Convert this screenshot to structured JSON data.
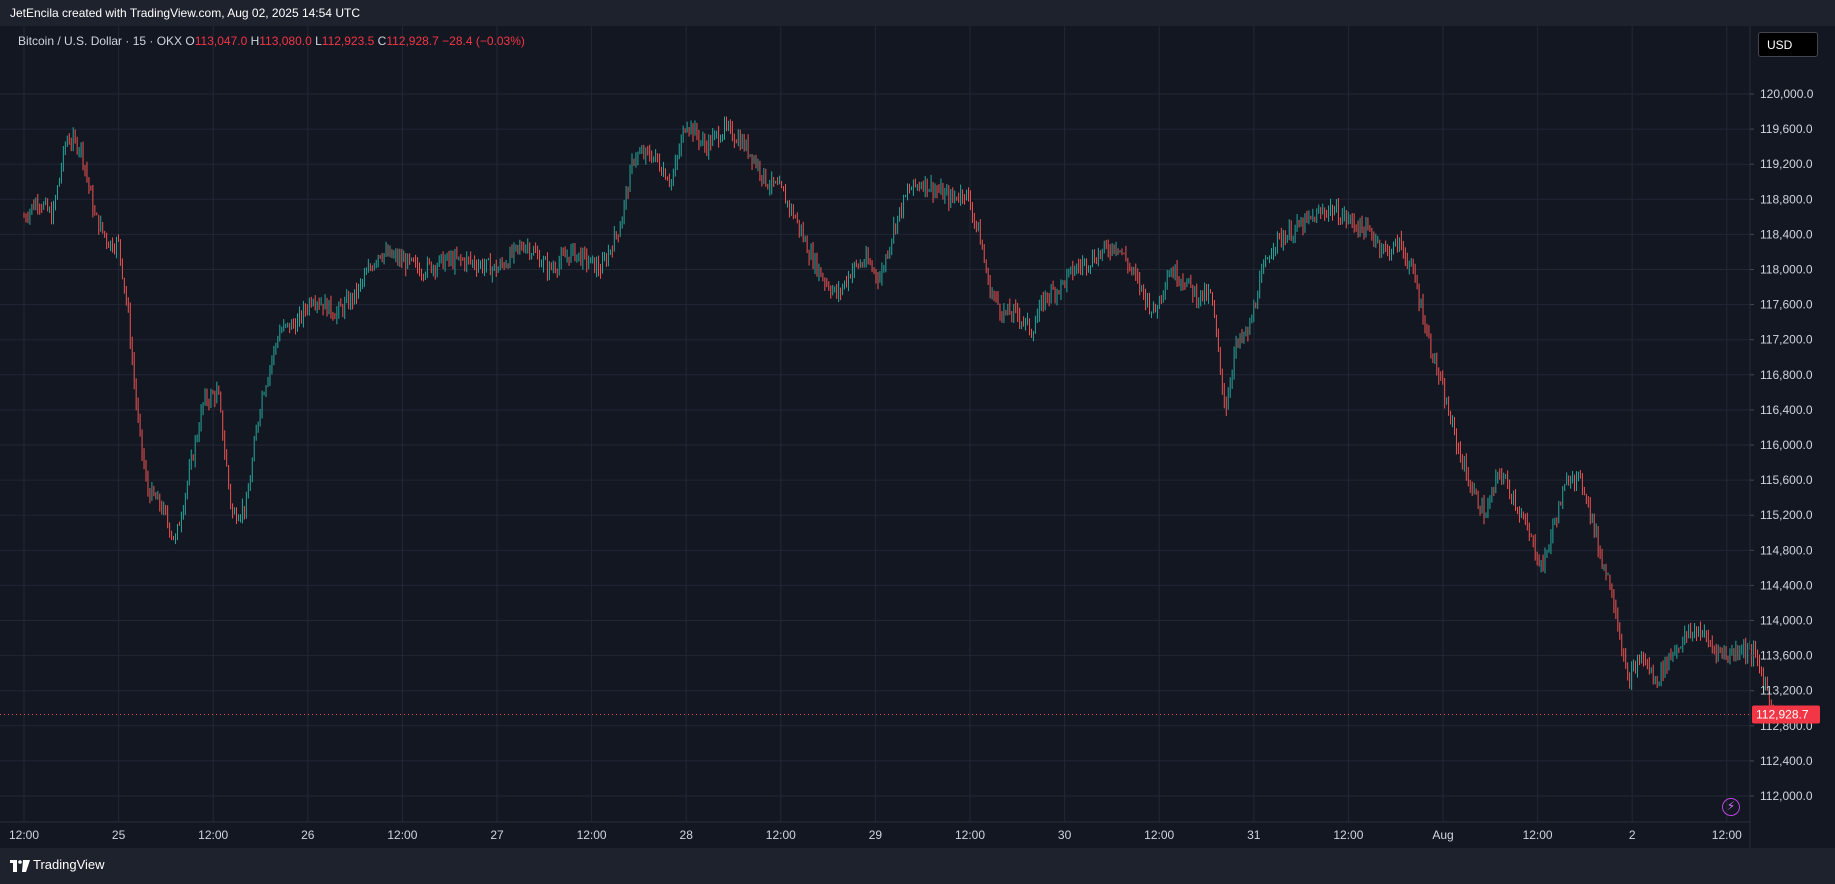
{
  "header": {
    "caption": "JetEncila created with TradingView.com, Aug 02, 2025 14:54 UTC"
  },
  "legend": {
    "symbol": "Bitcoin / U.S. Dollar · 15 · OKX",
    "o_label": "O",
    "o_value": "113,047.0",
    "h_label": "H",
    "h_value": "113,080.0",
    "l_label": "L",
    "l_value": "112,923.5",
    "c_label": "C",
    "c_value": "112,928.7",
    "change": "−28.4 (−0.03%)"
  },
  "currency_button": "USD",
  "last_price_label": "112,928.7",
  "footer": {
    "brand": "TradingView"
  },
  "colors": {
    "background": "#131722",
    "grid": "#232735",
    "up": "#26a69a",
    "down": "#ef5350",
    "axis_text": "#d1d4dc"
  },
  "chart_data": {
    "type": "candlestick",
    "interval": "15",
    "exchange": "OKX",
    "ylim": [
      112000,
      120000
    ],
    "y_ticks": [
      "120,000.0",
      "119,600.0",
      "119,200.0",
      "118,800.0",
      "118,400.0",
      "118,000.0",
      "117,600.0",
      "117,200.0",
      "116,800.0",
      "116,400.0",
      "116,000.0",
      "115,600.0",
      "115,200.0",
      "114,800.0",
      "114,400.0",
      "114,000.0",
      "113,600.0",
      "113,200.0",
      "112,800.0",
      "112,400.0",
      "112,000.0"
    ],
    "x_ticks": [
      "12:00",
      "25",
      "12:00",
      "26",
      "12:00",
      "27",
      "12:00",
      "28",
      "12:00",
      "29",
      "12:00",
      "30",
      "12:00",
      "31",
      "12:00",
      "Aug",
      "12:00",
      "2",
      "12:00"
    ],
    "x_tick_index": [
      0,
      1,
      2,
      3,
      4,
      5,
      6,
      7,
      8,
      9,
      10,
      11,
      12,
      13,
      14,
      15,
      16,
      17,
      18
    ],
    "close_path": [
      [
        0,
        118600
      ],
      [
        0.15,
        118800
      ],
      [
        0.3,
        118600
      ],
      [
        0.45,
        119500
      ],
      [
        0.6,
        119400
      ],
      [
        0.75,
        118600
      ],
      [
        0.9,
        118300
      ],
      [
        1.0,
        118300
      ],
      [
        1.1,
        117500
      ],
      [
        1.2,
        116300
      ],
      [
        1.3,
        115500
      ],
      [
        1.45,
        115300
      ],
      [
        1.6,
        114900
      ],
      [
        1.75,
        115700
      ],
      [
        1.9,
        116500
      ],
      [
        2.05,
        116600
      ],
      [
        2.2,
        115200
      ],
      [
        2.35,
        115300
      ],
      [
        2.5,
        116500
      ],
      [
        2.7,
        117300
      ],
      [
        2.9,
        117400
      ],
      [
        3.05,
        117700
      ],
      [
        3.3,
        117500
      ],
      [
        3.5,
        117700
      ],
      [
        3.75,
        118200
      ],
      [
        4.0,
        118100
      ],
      [
        4.2,
        118000
      ],
      [
        4.45,
        118100
      ],
      [
        4.7,
        118100
      ],
      [
        5.0,
        118000
      ],
      [
        5.3,
        118300
      ],
      [
        5.55,
        118000
      ],
      [
        5.8,
        118200
      ],
      [
        6.1,
        118000
      ],
      [
        6.3,
        118500
      ],
      [
        6.45,
        119300
      ],
      [
        6.65,
        119300
      ],
      [
        6.85,
        119000
      ],
      [
        7.0,
        119700
      ],
      [
        7.2,
        119400
      ],
      [
        7.4,
        119600
      ],
      [
        7.55,
        119500
      ],
      [
        7.7,
        119300
      ],
      [
        7.85,
        119000
      ],
      [
        8.0,
        118900
      ],
      [
        8.15,
        118600
      ],
      [
        8.3,
        118200
      ],
      [
        8.45,
        117900
      ],
      [
        8.6,
        117700
      ],
      [
        8.75,
        118000
      ],
      [
        8.9,
        118100
      ],
      [
        9.05,
        117900
      ],
      [
        9.2,
        118500
      ],
      [
        9.35,
        118900
      ],
      [
        9.5,
        119000
      ],
      [
        9.65,
        118900
      ],
      [
        9.8,
        118800
      ],
      [
        9.95,
        118900
      ],
      [
        10.1,
        118400
      ],
      [
        10.2,
        117800
      ],
      [
        10.35,
        117500
      ],
      [
        10.5,
        117500
      ],
      [
        10.65,
        117300
      ],
      [
        10.8,
        117700
      ],
      [
        10.95,
        117800
      ],
      [
        11.1,
        118000
      ],
      [
        11.25,
        118100
      ],
      [
        11.4,
        118200
      ],
      [
        11.55,
        118300
      ],
      [
        11.7,
        118000
      ],
      [
        11.85,
        117700
      ],
      [
        11.95,
        117500
      ],
      [
        12.1,
        118000
      ],
      [
        12.25,
        117900
      ],
      [
        12.4,
        117700
      ],
      [
        12.55,
        117700
      ],
      [
        12.7,
        116400
      ],
      [
        12.8,
        117100
      ],
      [
        12.95,
        117300
      ],
      [
        13.05,
        117800
      ],
      [
        13.2,
        118300
      ],
      [
        13.35,
        118400
      ],
      [
        13.5,
        118500
      ],
      [
        13.65,
        118600
      ],
      [
        13.8,
        118700
      ],
      [
        13.95,
        118600
      ],
      [
        14.1,
        118500
      ],
      [
        14.25,
        118400
      ],
      [
        14.4,
        118200
      ],
      [
        14.55,
        118300
      ],
      [
        14.7,
        117900
      ],
      [
        14.85,
        117200
      ],
      [
        15.0,
        116600
      ],
      [
        15.15,
        116000
      ],
      [
        15.3,
        115500
      ],
      [
        15.45,
        115200
      ],
      [
        15.6,
        115700
      ],
      [
        15.75,
        115400
      ],
      [
        15.9,
        115000
      ],
      [
        16.05,
        114600
      ],
      [
        16.2,
        115200
      ],
      [
        16.35,
        115700
      ],
      [
        16.5,
        115500
      ],
      [
        16.65,
        114800
      ],
      [
        16.8,
        114300
      ],
      [
        16.95,
        113300
      ],
      [
        17.1,
        113600
      ],
      [
        17.25,
        113300
      ],
      [
        17.4,
        113600
      ],
      [
        17.55,
        113800
      ],
      [
        17.7,
        113900
      ],
      [
        17.85,
        113700
      ],
      [
        18.0,
        113600
      ],
      [
        18.15,
        113700
      ],
      [
        18.3,
        113600
      ],
      [
        18.4,
        113300
      ],
      [
        18.5,
        112930
      ]
    ],
    "last_close": 112928.7,
    "open": 113047.0,
    "high": 113080.0,
    "low": 112923.5,
    "change": -28.4,
    "change_percent": -0.03
  }
}
